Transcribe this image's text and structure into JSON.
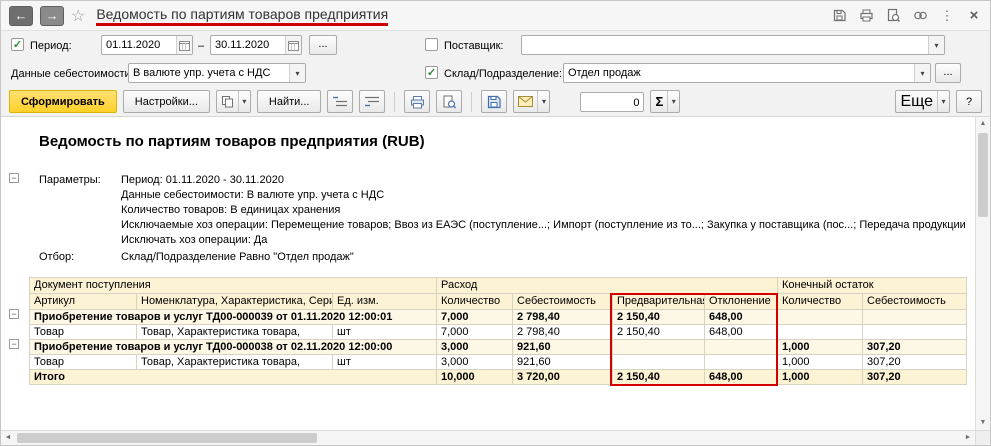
{
  "colors": {
    "annotation_red": "#d40000",
    "generate_yellow": "#ffd028",
    "header_cream": "#fcf2d4",
    "check_green": "#2f8f2f"
  },
  "icons": {
    "back": "←",
    "forward": "→",
    "star": "☆",
    "kebab": "⋮",
    "close": "×",
    "caret": "▾",
    "up": "▲",
    "down": "▼",
    "left": "◄",
    "right": "►",
    "minus": "−",
    "check": "✓",
    "dash": "–",
    "ellipsis": "..."
  },
  "topbar": {
    "title": "Ведомость по партиям товаров предприятия"
  },
  "filters": {
    "period": {
      "label": "Период:",
      "from": "01.11.2020",
      "to": "30.11.2020"
    },
    "supplier": {
      "label": "Поставщик:",
      "value": ""
    },
    "cost": {
      "label": "Данные себестоимости:",
      "value": "В валюте упр. учета с НДС"
    },
    "warehouse": {
      "label": "Склад/Подразделение:",
      "value": "Отдел продаж"
    }
  },
  "toolbar": {
    "generate": "Сформировать",
    "settings": "Настройки...",
    "find": "Найти...",
    "counter": "0",
    "sigma": "Σ",
    "more": "Еще",
    "help": "?"
  },
  "report": {
    "title": "Ведомость по партиям товаров предприятия (RUB)",
    "params_label": "Параметры:",
    "param_lines": [
      "Период: 01.11.2020 - 30.11.2020",
      "Данные себестоимости: В валюте упр. учета с НДС",
      "Количество товаров: В единицах хранения",
      "Исключаемые хоз операции: Перемещение товаров; Ввоз из ЕАЭС (поступление...; Импорт (поступление из то...; Закупка у поставщика (пос...; Передача продукции",
      "Исключать хоз операции: Да"
    ],
    "otbor_label": "Отбор:",
    "otbor_value": "Склад/Подразделение Равно \"Отдел продаж\""
  },
  "table": {
    "group_headers": [
      {
        "label": "Документ поступления",
        "span": 3
      },
      {
        "label": "Расход",
        "span": 4
      },
      {
        "label": "Конечный остаток",
        "span": 2
      }
    ],
    "columns": [
      "Артикул",
      "Номенклатура, Характеристика, Серия",
      "Ед. изм.",
      "Количество",
      "Себестоимость",
      "Предварительная",
      "Отклонение",
      "Количество",
      "Себестоимость"
    ],
    "rows": [
      {
        "type": "group",
        "label": "Приобретение товаров и услуг ТД00-000039 от 01.11.2020 12:00:01",
        "values": [
          "7,000",
          "2 798,40",
          "2 150,40",
          "648,00",
          "",
          ""
        ]
      },
      {
        "type": "detail",
        "cells": [
          "Товар",
          "Товар, Характеристика товара,",
          "шт"
        ],
        "values": [
          "7,000",
          "2 798,40",
          "2 150,40",
          "648,00",
          "",
          ""
        ]
      },
      {
        "type": "group",
        "label": "Приобретение товаров и услуг ТД00-000038 от 02.11.2020 12:00:00",
        "values": [
          "3,000",
          "921,60",
          "",
          "",
          "1,000",
          "307,20"
        ]
      },
      {
        "type": "detail",
        "cells": [
          "Товар",
          "Товар, Характеристика товара,",
          "шт"
        ],
        "values": [
          "3,000",
          "921,60",
          "",
          "",
          "1,000",
          "307,20"
        ]
      },
      {
        "type": "total",
        "label": "Итого",
        "values": [
          "10,000",
          "3 720,00",
          "2 150,40",
          "648,00",
          "1,000",
          "307,20"
        ]
      }
    ]
  }
}
